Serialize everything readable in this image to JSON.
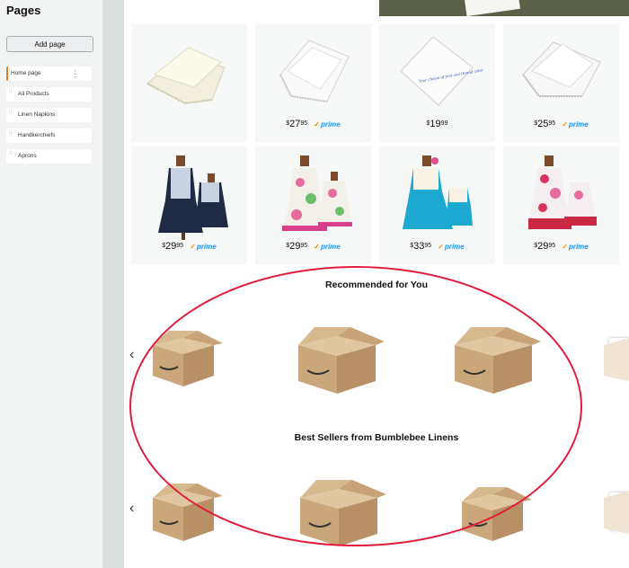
{
  "sidebar": {
    "title": "Pages",
    "add_button": "Add page",
    "items": [
      {
        "label": "Home page"
      },
      {
        "label": "All Products"
      },
      {
        "label": "Linen Napkins"
      },
      {
        "label": "Handkerchiefs"
      },
      {
        "label": "Aprons"
      }
    ]
  },
  "products": {
    "row1": [
      {
        "dollars": "",
        "cents": "",
        "prime": false
      },
      {
        "dollars": "27",
        "cents": "95",
        "prime": true
      },
      {
        "dollars": "19",
        "cents": "99",
        "prime": false
      },
      {
        "dollars": "25",
        "cents": "95",
        "prime": true
      }
    ],
    "row2": [
      {
        "dollars": "29",
        "cents": "95",
        "prime": true
      },
      {
        "dollars": "29",
        "cents": "95",
        "prime": true
      },
      {
        "dollars": "33",
        "cents": "95",
        "prime": true
      },
      {
        "dollars": "29",
        "cents": "95",
        "prime": true
      }
    ],
    "currency": "$",
    "prime_label": "prime",
    "hanky_text": "Your choice of text and thread color"
  },
  "sections": {
    "recommended": "Recommended for You",
    "best_sellers": "Best Sellers from Bumblebee Linens"
  },
  "colors": {
    "accent": "#e07b2b",
    "prime_blue": "#1a98ff",
    "annotation_red": "#e21b3c"
  }
}
